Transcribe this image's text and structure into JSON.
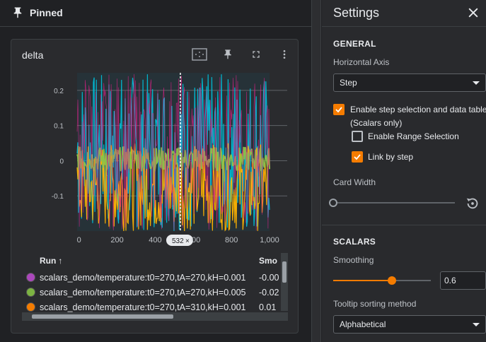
{
  "pinned": {
    "title": "Pinned",
    "icon": "pin-icon"
  },
  "card": {
    "title": "delta",
    "tools": [
      "fit-to-data-icon",
      "pin-icon",
      "fullscreen-icon",
      "more-vert-icon"
    ]
  },
  "chart_data": {
    "type": "line",
    "title": "delta",
    "xlabel": "",
    "ylabel": "",
    "x_ticks": [
      "0",
      "200",
      "400",
      "600",
      "800",
      "1,000"
    ],
    "y_ticks": [
      "-0.1",
      "0",
      "0.1",
      "0.2"
    ],
    "xlim": [
      -10,
      1000
    ],
    "ylim": [
      -0.2,
      0.25
    ],
    "hover_step": "532",
    "grid": true,
    "series": [
      {
        "color": "#00bcd4",
        "range": [
          -0.2,
          0.25
        ]
      },
      {
        "color": "#ffb300",
        "range": [
          -0.2,
          0.05
        ]
      },
      {
        "color": "#8bc34a",
        "range": [
          -0.03,
          0.04
        ]
      },
      {
        "color": "#e91e8c",
        "range": [
          -0.2,
          0.25
        ]
      }
    ]
  },
  "table": {
    "headers": {
      "run": "Run",
      "smoothed": "Smo"
    },
    "rows": [
      {
        "color": "#ab47bc",
        "name": "scalars_demo/temperature:t0=270,tA=270,kH=0.001",
        "value": "-0.00"
      },
      {
        "color": "#7cb342",
        "name": "scalars_demo/temperature:t0=270,tA=270,kH=0.005",
        "value": "-0.02"
      },
      {
        "color": "#f57c00",
        "name": "scalars_demo/temperature:t0=270,tA=310,kH=0.001",
        "value": "0.01"
      }
    ]
  },
  "settings": {
    "title": "Settings",
    "general": {
      "heading": "GENERAL",
      "horizontal_axis_label": "Horizontal Axis",
      "horizontal_axis_value": "Step",
      "step_selection_label_line1": "Enable step selection and data table",
      "step_selection_label_line2": "(Scalars only)",
      "step_selection_checked": true,
      "range_selection_label": "Enable Range Selection",
      "range_selection_checked": false,
      "link_by_step_label": "Link by step",
      "link_by_step_checked": true,
      "card_width_label": "Card Width"
    },
    "scalars": {
      "heading": "SCALARS",
      "smoothing_label": "Smoothing",
      "smoothing_value": "0.6",
      "smoothing_fraction": 0.6,
      "tooltip_sort_label": "Tooltip sorting method",
      "tooltip_sort_value": "Alphabetical"
    },
    "accent": "#f57c00"
  }
}
